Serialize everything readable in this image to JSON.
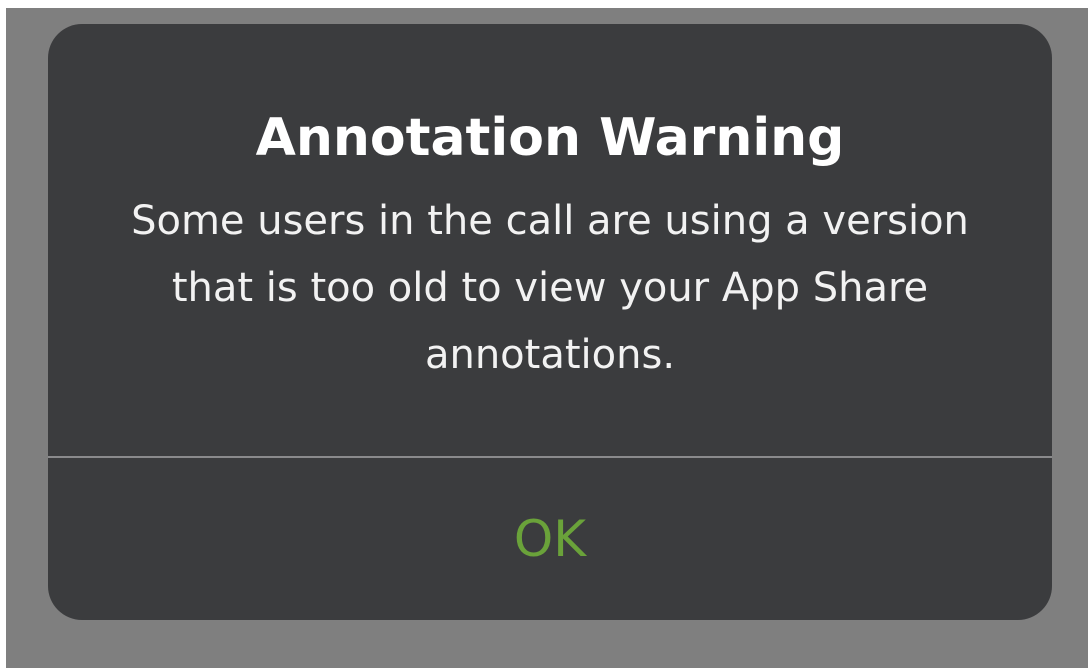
{
  "dialog": {
    "title": "Annotation Warning",
    "message": "Some users in the call are using a version that is too old to view your App Share annotations.",
    "ok_label": "OK"
  },
  "colors": {
    "backdrop": "#7f7f7f",
    "dialog_background": "#3b3c3e",
    "title_text": "#ffffff",
    "message_text": "#f2f2f2",
    "divider": "#8a8a8c",
    "accent": "#6aa23a"
  }
}
